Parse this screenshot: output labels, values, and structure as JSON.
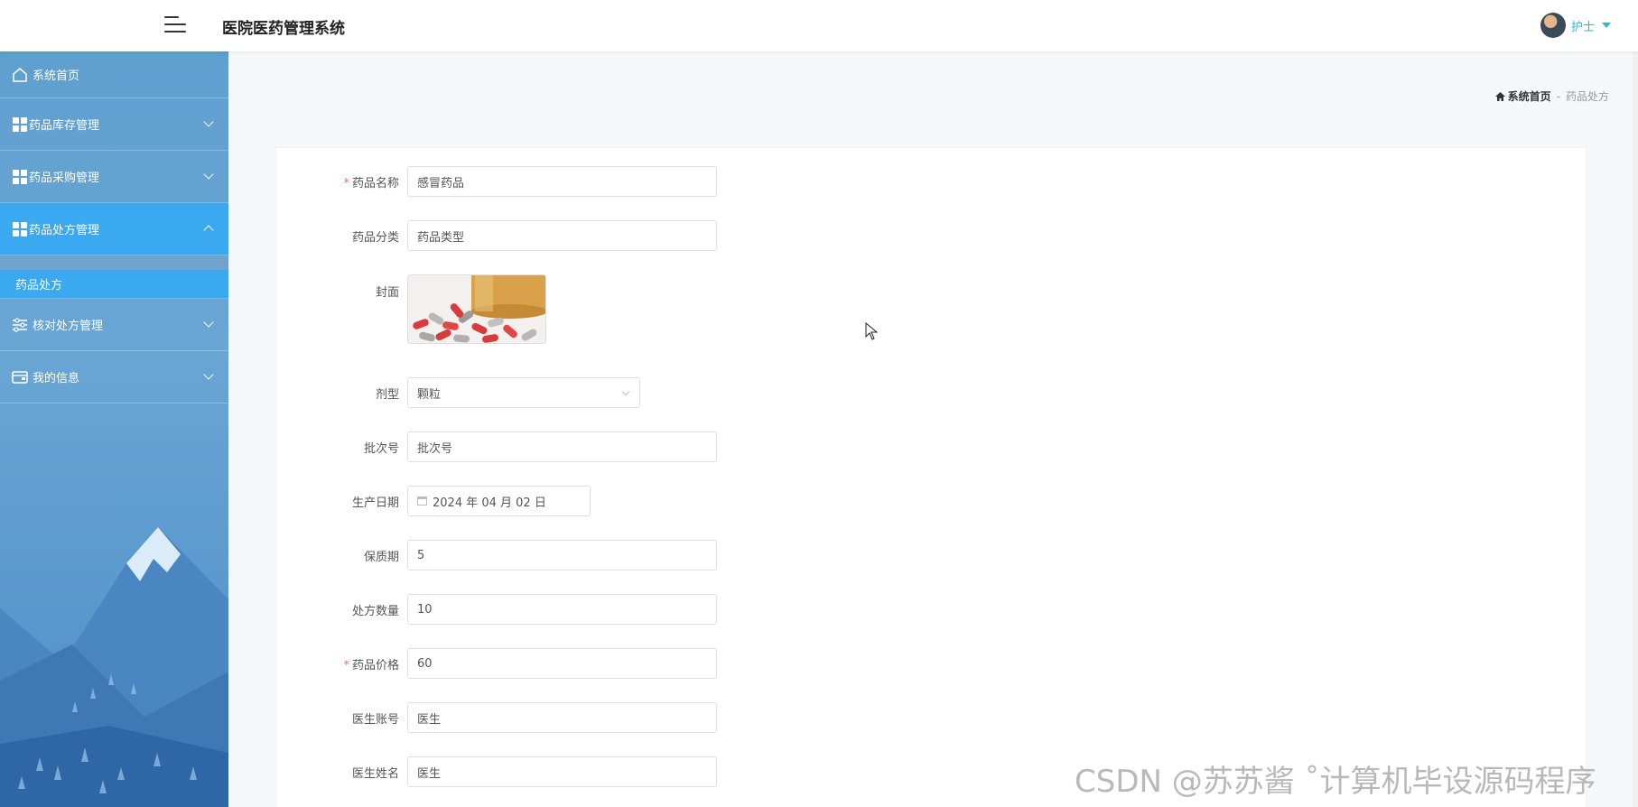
{
  "header": {
    "title": "医院医药管理系统",
    "user": "护士"
  },
  "sidebar": {
    "items": [
      {
        "label": "系统首页",
        "icon": "home-icon"
      },
      {
        "label": "药品库存管理",
        "icon": "grid-icon"
      },
      {
        "label": "药品采购管理",
        "icon": "grid-icon"
      },
      {
        "label": "药品处方管理",
        "icon": "grid-icon",
        "expanded": true
      },
      {
        "label": "核对处方管理",
        "icon": "sliders-icon"
      },
      {
        "label": "我的信息",
        "icon": "wallet-icon"
      }
    ],
    "sub_items": [
      {
        "label": "药品处方"
      }
    ]
  },
  "breadcrumb": {
    "home": "系统首页",
    "separator": "-",
    "current": "药品处方"
  },
  "form": {
    "name_label": "药品名称",
    "name_value": "感冒药品",
    "category_label": "药品分类",
    "category_value": "药品类型",
    "cover_label": "封面",
    "dosage_label": "剂型",
    "dosage_value": "颗粒",
    "batch_label": "批次号",
    "batch_value": "批次号",
    "date_label": "生产日期",
    "date_value": "2024 年 04 月 02 日",
    "shelf_label": "保质期",
    "shelf_value": "5",
    "qty_label": "处方数量",
    "qty_value": "10",
    "price_label": "药品价格",
    "price_value": "60",
    "doc_account_label": "医生账号",
    "doc_account_value": "医生",
    "doc_name_label": "医生姓名",
    "doc_name_value": "医生",
    "required_mark": "*"
  },
  "watermark": "CSDN @苏苏酱    ˚计算机毕设源码程序",
  "colors": {
    "accent": "#3ba9f0",
    "user_text": "#2fb6d8",
    "required": "#f56c6c"
  }
}
